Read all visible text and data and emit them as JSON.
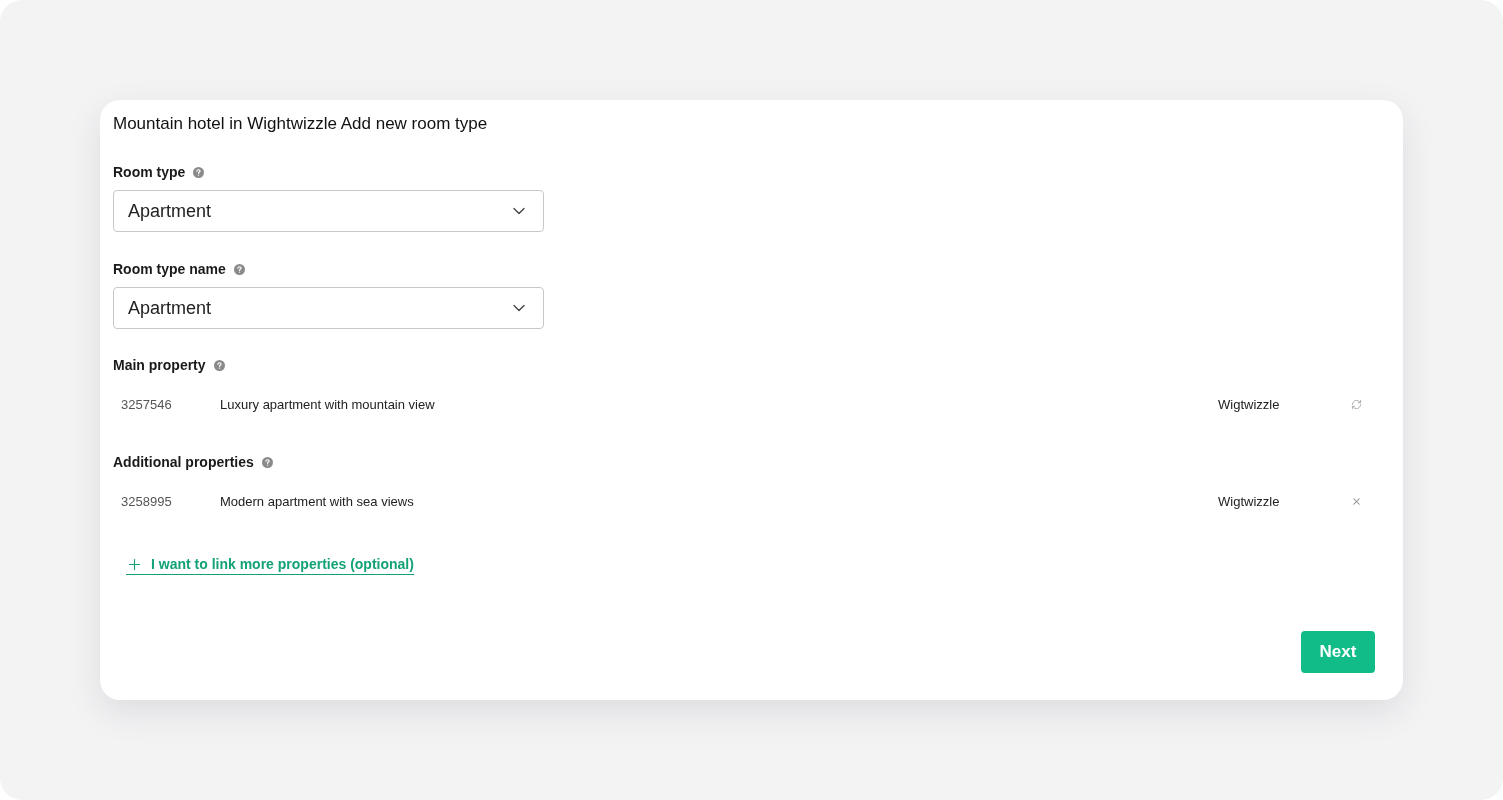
{
  "title": "Mountain hotel in Wightwizzle Add new room type",
  "fields": [
    {
      "label": "Room type",
      "value": "Apartment"
    },
    {
      "label": "Room type name",
      "value": "Apartment"
    }
  ],
  "sections": [
    {
      "kind": "main",
      "label": "Main property",
      "properties": [
        {
          "id": "3257546",
          "name": "Luxury apartment with mountain view",
          "location": "Wigtwizzle"
        }
      ]
    },
    {
      "kind": "additional",
      "label": "Additional properties",
      "properties": [
        {
          "id": "3258995",
          "name": "Modern apartment with sea views",
          "location": "Wigtwizzle"
        }
      ]
    }
  ],
  "link": {
    "label": "I want to link more properties (optional)"
  },
  "buttons": [
    {
      "label": "Next"
    }
  ]
}
